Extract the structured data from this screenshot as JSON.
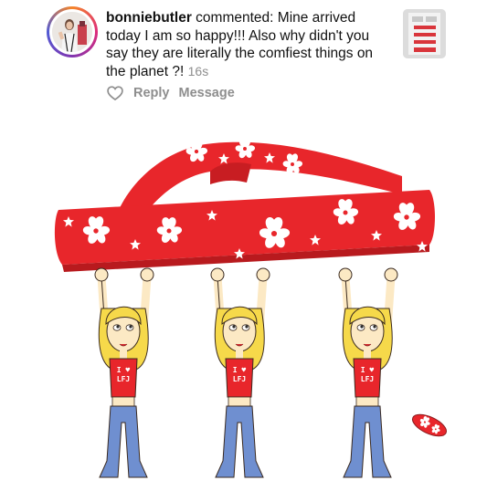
{
  "comment": {
    "username": "bonniebutler",
    "verb": "commented:",
    "text": "Mine arrived today I am so happy!!! Also why didn't you say they are literally the comfiest things on the planet ?!",
    "time": "16s",
    "actions": {
      "reply": "Reply",
      "message": "Message"
    },
    "icons": {
      "like": "heart-outline-icon"
    }
  },
  "image": {
    "shirt_text": [
      "I ♥",
      "LFJ"
    ],
    "colors": {
      "sandal_red": "#e8262b",
      "denim": "#6f8fd0",
      "hair": "#f6d94a",
      "skin": "#fce9c4"
    }
  }
}
